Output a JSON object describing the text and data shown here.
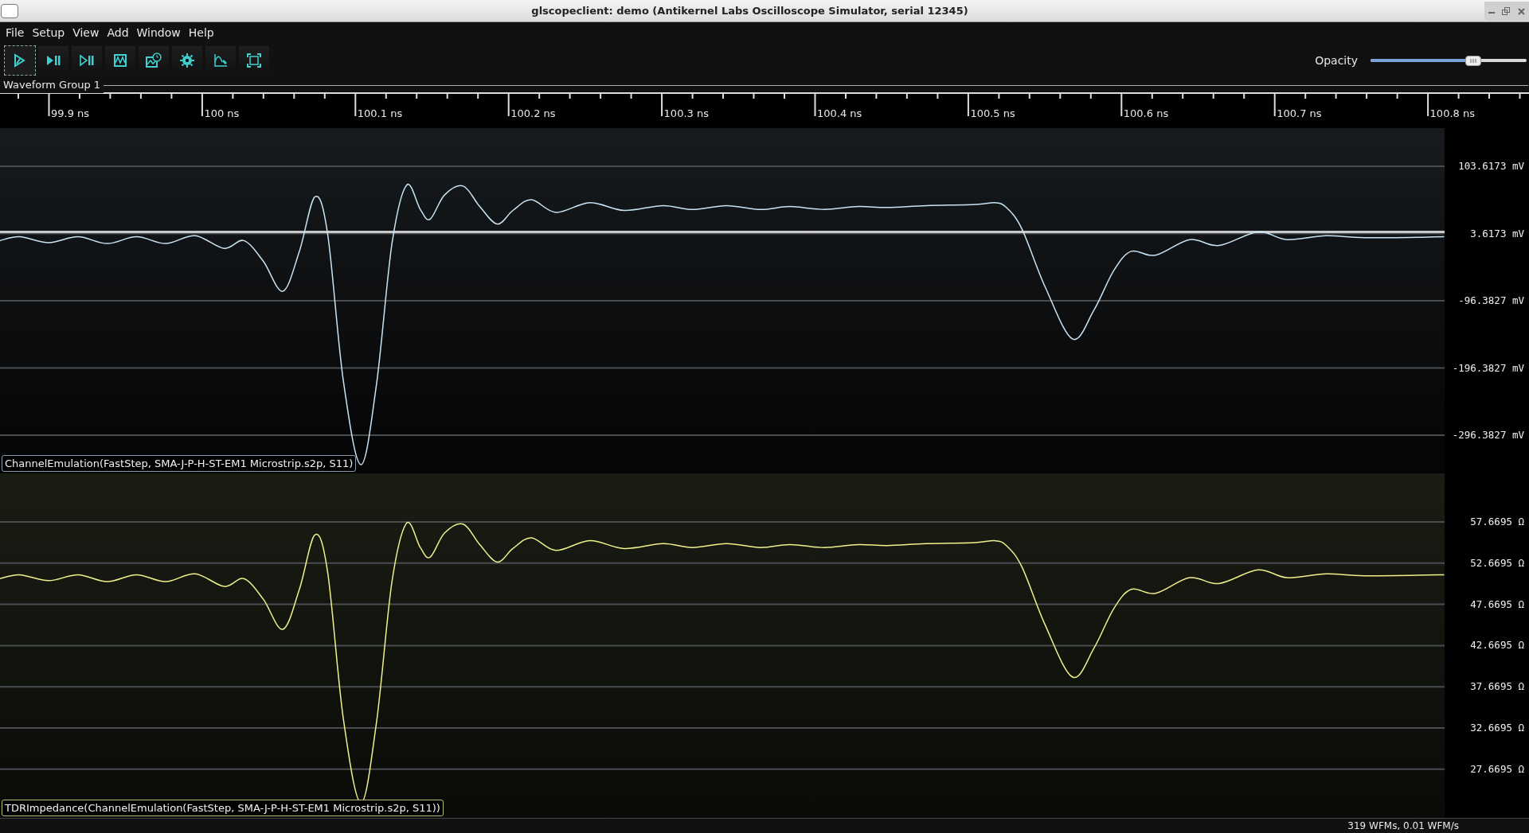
{
  "window": {
    "title": "glscopeclient: demo (Antikernel Labs Oscilloscope Simulator, serial 12345)"
  },
  "menu": [
    "File",
    "Setup",
    "View",
    "Add",
    "Window",
    "Help"
  ],
  "toolbar": [
    {
      "kind": "start",
      "focused": true
    },
    {
      "kind": "single",
      "focused": false
    },
    {
      "kind": "force",
      "focused": false
    },
    {
      "kind": "history",
      "focused": false
    },
    {
      "kind": "timebase",
      "focused": false
    },
    {
      "kind": "refresh",
      "focused": false
    },
    {
      "kind": "analyze",
      "focused": false
    },
    {
      "kind": "fullscreen",
      "focused": false
    }
  ],
  "opacity": {
    "label": "Opacity",
    "level": 0.66
  },
  "group": {
    "title": "Waveform Group 1"
  },
  "timeline": [
    "99.9 ns",
    "100 ns",
    "100.1 ns",
    "100.2 ns",
    "100.3 ns",
    "100.4 ns",
    "100.5 ns",
    "100.6 ns",
    "100.7 ns",
    "100.8 ns"
  ],
  "plots": [
    {
      "label": "ChannelEmulation(FastStep, SMA-J-P-H-ST-EM1 Microstrip.s2p, S11)",
      "color": "#c8e4f4",
      "y_labels": [
        "103.6173 mV",
        "3.6173 mV",
        "-96.3827 mV",
        "-196.3827 mV",
        "-296.3827 mV"
      ]
    },
    {
      "label": "TDRImpedance(ChannelEmulation(FastStep, SMA-J-P-H-ST-EM1 Microstrip.s2p, S11))",
      "color": "#f0f08c",
      "y_labels": [
        "57.6695 Ω",
        "52.6695 Ω",
        "47.6695 Ω",
        "42.6695 Ω",
        "37.6695 Ω",
        "32.6695 Ω",
        "27.6695 Ω"
      ]
    }
  ],
  "status_bar": "319 WFMs, 0.01 WFM/s"
}
